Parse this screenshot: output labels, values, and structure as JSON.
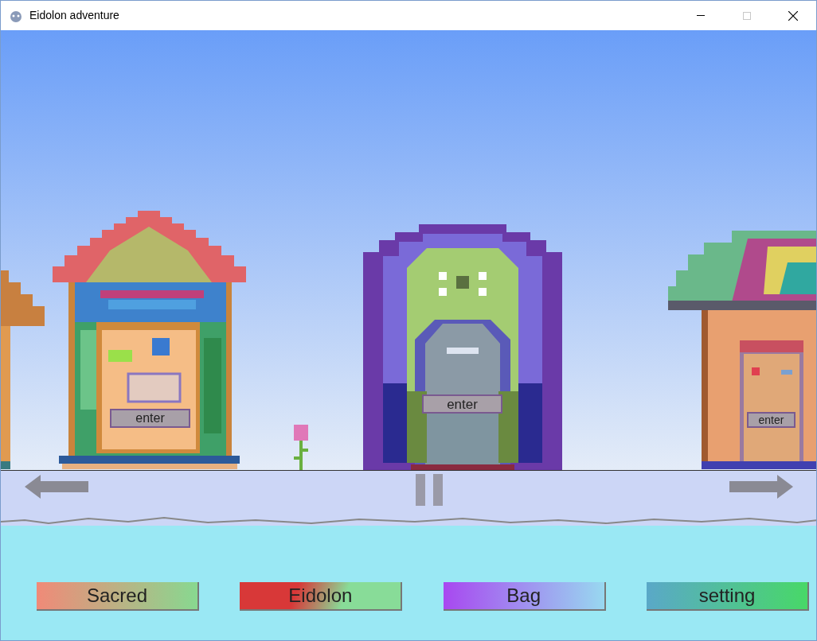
{
  "window": {
    "title": "Eidolon adventure"
  },
  "buildings": [
    {
      "kind": "shop",
      "button": "enter"
    },
    {
      "kind": "portal",
      "button": "enter"
    },
    {
      "kind": "house",
      "button": "enter"
    }
  ],
  "menu_buttons": [
    {
      "label": "Sacred"
    },
    {
      "label": "Eidolon"
    },
    {
      "label": "Bag"
    },
    {
      "label": "setting"
    }
  ]
}
